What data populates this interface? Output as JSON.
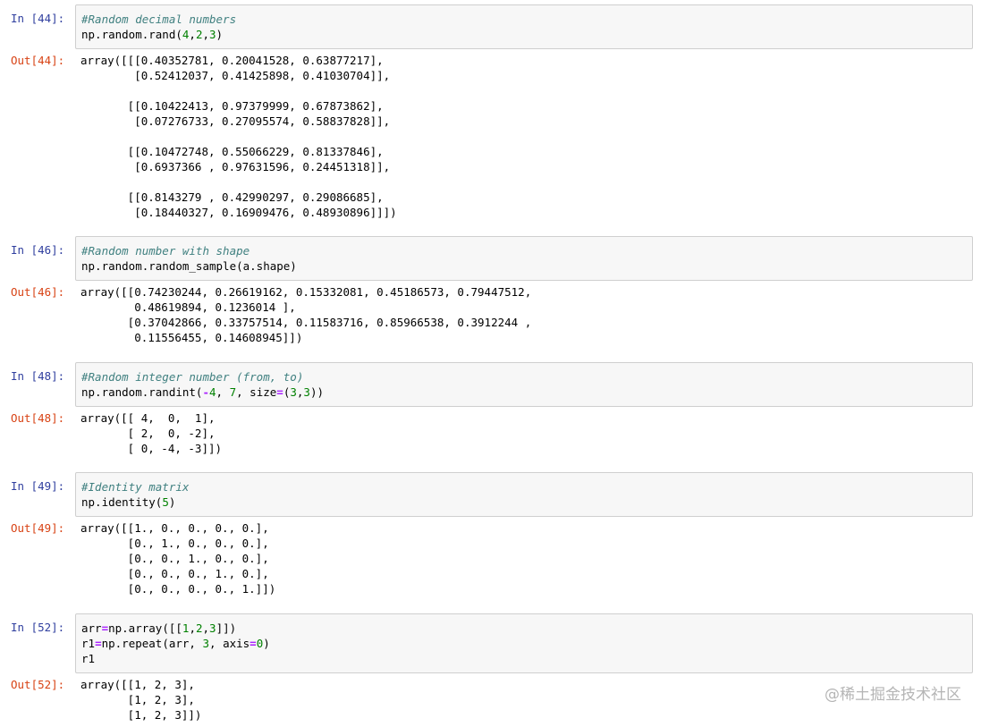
{
  "cells": [
    {
      "in_prompt": "In [44]:",
      "out_prompt": "Out[44]:",
      "input": [
        "#Random decimal numbers",
        "np.random.rand(4,2,3)"
      ],
      "output": [
        "array([[[0.40352781, 0.20041528, 0.63877217],",
        "        [0.52412037, 0.41425898, 0.41030704]],",
        "",
        "       [[0.10422413, 0.97379999, 0.67873862],",
        "        [0.07276733, 0.27095574, 0.58837828]],",
        "",
        "       [[0.10472748, 0.55066229, 0.81337846],",
        "        [0.6937366 , 0.97631596, 0.24451318]],",
        "",
        "       [[0.8143279 , 0.42990297, 0.29086685],",
        "        [0.18440327, 0.16909476, 0.48930896]]])"
      ]
    },
    {
      "in_prompt": "In [46]:",
      "out_prompt": "Out[46]:",
      "input": [
        "#Random number with shape",
        "np.random.random_sample(a.shape)"
      ],
      "output": [
        "array([[0.74230244, 0.26619162, 0.15332081, 0.45186573, 0.79447512,",
        "        0.48619894, 0.1236014 ],",
        "       [0.37042866, 0.33757514, 0.11583716, 0.85966538, 0.3912244 ,",
        "        0.11556455, 0.14608945]])"
      ]
    },
    {
      "in_prompt": "In [48]:",
      "out_prompt": "Out[48]:",
      "input": [
        "#Random integer number (from, to)",
        "np.random.randint(-4, 7, size=(3,3))"
      ],
      "output": [
        "array([[ 4,  0,  1],",
        "       [ 2,  0, -2],",
        "       [ 0, -4, -3]])"
      ]
    },
    {
      "in_prompt": "In [49]:",
      "out_prompt": "Out[49]:",
      "input": [
        "#Identity matrix",
        "np.identity(5)"
      ],
      "output": [
        "array([[1., 0., 0., 0., 0.],",
        "       [0., 1., 0., 0., 0.],",
        "       [0., 0., 1., 0., 0.],",
        "       [0., 0., 0., 1., 0.],",
        "       [0., 0., 0., 0., 1.]])"
      ]
    },
    {
      "in_prompt": "In [52]:",
      "out_prompt": "Out[52]:",
      "input": [
        "arr=np.array([[1,2,3]])",
        "r1=np.repeat(arr, 3, axis=0)",
        "r1"
      ],
      "output": [
        "array([[1, 2, 3],",
        "       [1, 2, 3],",
        "       [1, 2, 3]])"
      ]
    }
  ],
  "watermark": "@稀土掘金技术社区",
  "colors": {
    "in_prompt": "#303f9f",
    "out_prompt": "#d84315",
    "comment": "#408080",
    "number": "#008000",
    "operator": "#aa22ff",
    "input_bg": "#f7f7f7",
    "input_border": "#cfcfcf"
  }
}
